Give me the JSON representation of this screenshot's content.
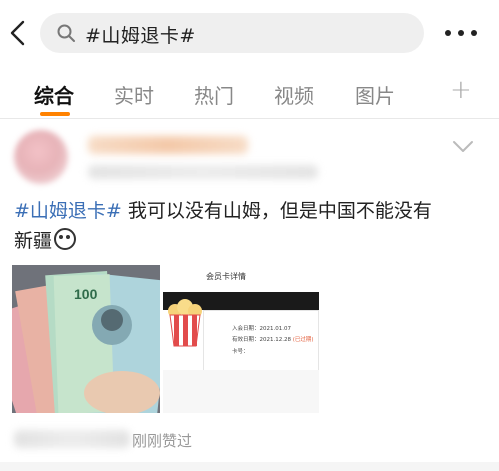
{
  "search": {
    "query": "#山姆退卡#"
  },
  "tabs": [
    {
      "label": "综合"
    },
    {
      "label": "实时"
    },
    {
      "label": "热门"
    },
    {
      "label": "视频"
    },
    {
      "label": "图片"
    }
  ],
  "tabs_add_label": "+",
  "post": {
    "hashtag": "#山姆退卡#",
    "text_line1": " 我可以没有山姆，但是中国不能没有",
    "text_line2": "新疆",
    "image2": {
      "title": "会员卡详情",
      "join_date": "入会日期：2021.01.07",
      "expire_date": "有效日期：2021.12.28",
      "status": "(已过期)",
      "card_no": "卡号："
    },
    "footer": "刚刚赞过"
  },
  "colors": {
    "accent_orange": "#ff8200",
    "hashtag_blue": "#3b6fb6",
    "expired_red": "#e25b38"
  }
}
